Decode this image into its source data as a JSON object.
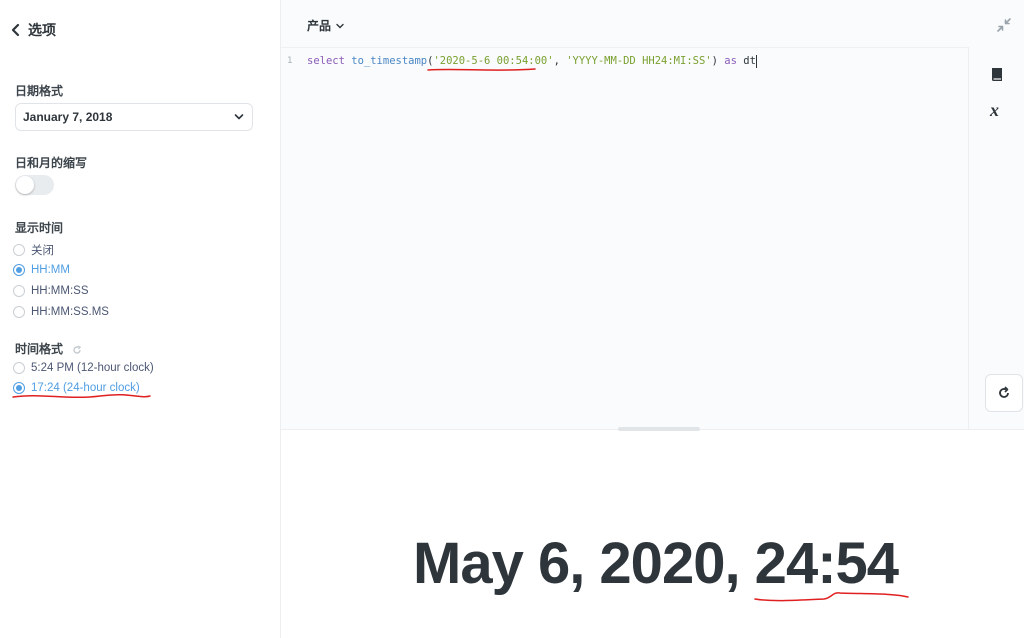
{
  "sidebar": {
    "back_label": "选项",
    "date_format": {
      "label": "日期格式",
      "value": "January 7, 2018"
    },
    "abbreviate": {
      "label": "日和月的缩写",
      "enabled": false
    },
    "show_time": {
      "label": "显示时间",
      "options": [
        "关闭",
        "HH:MM",
        "HH:MM:SS",
        "HH:MM:SS.MS"
      ],
      "selected": "HH:MM"
    },
    "time_format": {
      "label": "时间格式",
      "options": [
        "5:24 PM (12-hour clock)",
        "17:24 (24-hour clock)"
      ],
      "selected": "17:24 (24-hour clock)"
    }
  },
  "editor": {
    "database": "产品",
    "line_number": "1",
    "sql": {
      "kw_select": "select",
      "fn": "to_timestamp",
      "paren_open": "(",
      "arg1": "'2020-5-6 00:54:00'",
      "comma": ", ",
      "arg2": "'YYYY-MM-DD HH24:MI:SS'",
      "paren_close": ")",
      "kw_as": " as ",
      "alias": "dt"
    }
  },
  "result": {
    "value": "May 6, 2020, 24:54"
  },
  "icons": {
    "back": "chevron-left-icon",
    "dropdown": "chevron-down-icon",
    "collapse": "collapse-arrows-icon",
    "reference": "book-icon",
    "variables": "variable-x-icon",
    "run": "refresh-icon"
  },
  "colors": {
    "accent": "#509ee3",
    "annotation": "#e02020",
    "text": "#2e353b"
  }
}
